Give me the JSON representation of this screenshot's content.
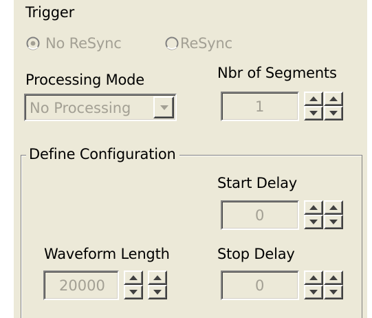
{
  "trigger": {
    "label": "Trigger",
    "options": [
      {
        "label": "No ReSync",
        "selected": true
      },
      {
        "label": "ReSync",
        "selected": false
      }
    ]
  },
  "processing_mode": {
    "label": "Processing Mode",
    "value": "No Processing"
  },
  "segments": {
    "label": "Nbr of Segments",
    "value": "1"
  },
  "define_configuration": {
    "label": "Define Configuration",
    "start_delay": {
      "label": "Start Delay",
      "value": "0"
    },
    "waveform_length": {
      "label": "Waveform Length",
      "value": "20000"
    },
    "stop_delay": {
      "label": "Stop Delay",
      "value": "0"
    }
  },
  "colors": {
    "panel_bg": "#ece9d8",
    "disabled_text": "#a3a094"
  },
  "icons": {
    "radio_selected": "radio-selected-icon",
    "radio_unselected": "radio-unselected-icon",
    "spin_up": "spin-up-arrow-icon",
    "spin_down": "spin-down-arrow-icon",
    "dropdown": "dropdown-arrow-icon"
  }
}
